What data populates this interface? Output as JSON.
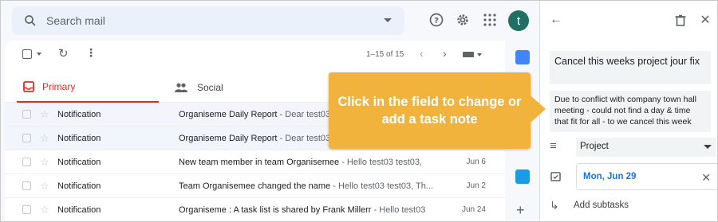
{
  "search": {
    "placeholder": "Search mail"
  },
  "header": {
    "avatar_initial": "t"
  },
  "toolbar": {
    "pagination": "1–15 of 15"
  },
  "tabs": [
    {
      "label": "Primary"
    },
    {
      "label": "Social"
    }
  ],
  "emails": [
    {
      "sender": "Notification",
      "subject": "Organiseme Daily Report",
      "snippet": " - Dear test03",
      "date": ""
    },
    {
      "sender": "Notification",
      "subject": "Organiseme Daily Report",
      "snippet": " - Dear test03",
      "date": ""
    },
    {
      "sender": "Notification",
      "subject": "New team member in team Organisemee",
      "snippet": " - Hello test03 test03,",
      "date": "Jun 6"
    },
    {
      "sender": "Notification",
      "subject": "Team Organisemee changed the name",
      "snippet": " - Hello test03 test03, Th...",
      "date": "Jun 2"
    },
    {
      "sender": "Notification",
      "subject": "Organiseme : A task list is shared by Frank Millerr",
      "snippet": " - Hello test03",
      "date": "Jun 24"
    }
  ],
  "task": {
    "title": "Cancel this weeks project jour fix",
    "note": "Due to conflict with company town hall meeting - could not find a day & time that fit for all - to we cancel this week",
    "list": "Project",
    "date": "Mon, Jun 29",
    "add_subtasks": "Add subtasks"
  },
  "callout": {
    "text": "Click in the field to change or add a task note"
  },
  "colors": {
    "accent_red": "#d93025",
    "callout": "#f2b33c",
    "blue": "#1a73e8"
  }
}
